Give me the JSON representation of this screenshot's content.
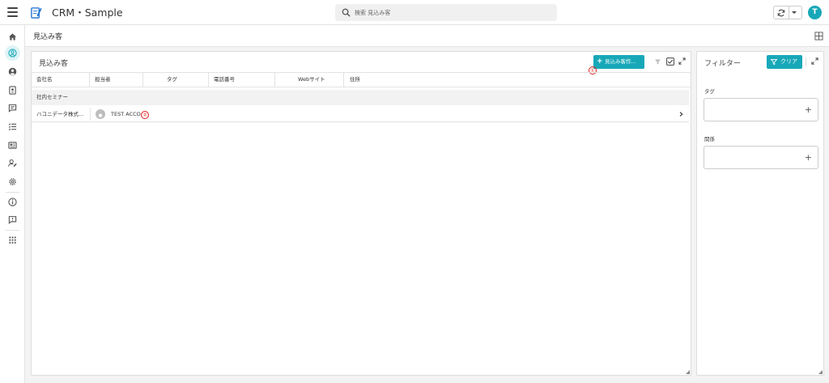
{
  "topbar": {
    "app_title": "CRM・Sample",
    "search_placeholder": "検索 見込み客",
    "user_initial": "T"
  },
  "breadcrumb": {
    "title": "見込み客"
  },
  "main_panel": {
    "title": "見込み客",
    "add_button_label": "見込み客作...",
    "columns": [
      "会社名",
      "担当者",
      "タグ",
      "電話番号",
      "Webサイト",
      "住所"
    ],
    "groups": [
      {
        "name": "社内セミナー",
        "rows": [
          {
            "company": "ハコニデータ株式...",
            "owner": "TEST ACCO"
          }
        ]
      }
    ],
    "annotations": [
      "①",
      "②"
    ]
  },
  "filter_panel": {
    "title": "フィルター",
    "clear_label": "クリア",
    "fields": [
      {
        "label": "タグ"
      },
      {
        "label": "関係"
      }
    ]
  },
  "colors": {
    "accent": "#17a8b8",
    "annotation": "#e01d1d"
  },
  "rail_icons": [
    "home-icon",
    "leads-icon",
    "account-circle-icon",
    "contact-card-icon",
    "comment-icon",
    "task-list-icon",
    "newspaper-icon",
    "user-edit-icon",
    "settings-icon",
    "info-icon",
    "feedback-icon",
    "apps-grid-icon"
  ]
}
